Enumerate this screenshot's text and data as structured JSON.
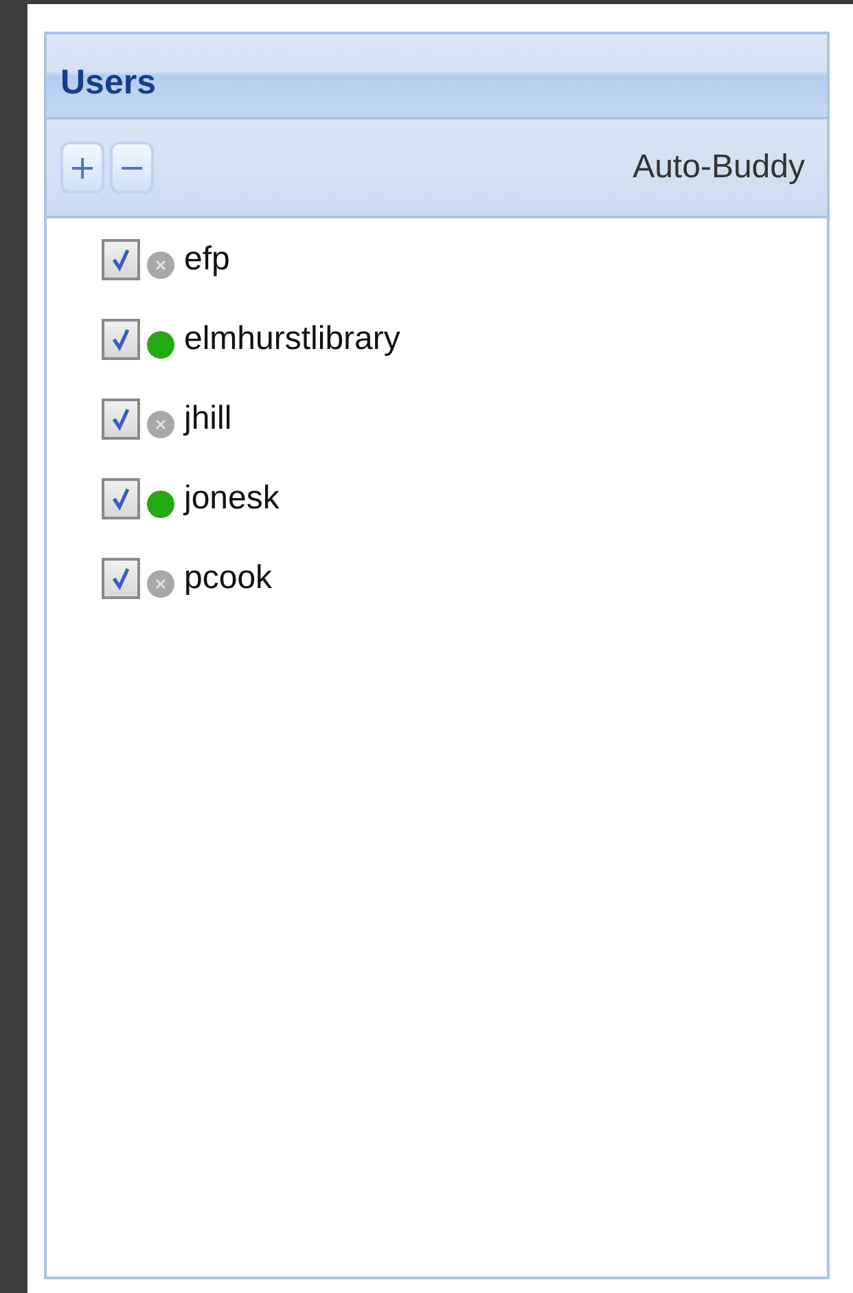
{
  "panel": {
    "title": "Users"
  },
  "toolbar": {
    "add": "+",
    "remove": "−",
    "label": "Auto-Buddy"
  },
  "users": [
    {
      "name": "efp",
      "checked": true,
      "online": false
    },
    {
      "name": "elmhurstlibrary",
      "checked": true,
      "online": true
    },
    {
      "name": "jhill",
      "checked": true,
      "online": false
    },
    {
      "name": "jonesk",
      "checked": true,
      "online": true
    },
    {
      "name": "pcook",
      "checked": true,
      "online": false
    }
  ]
}
